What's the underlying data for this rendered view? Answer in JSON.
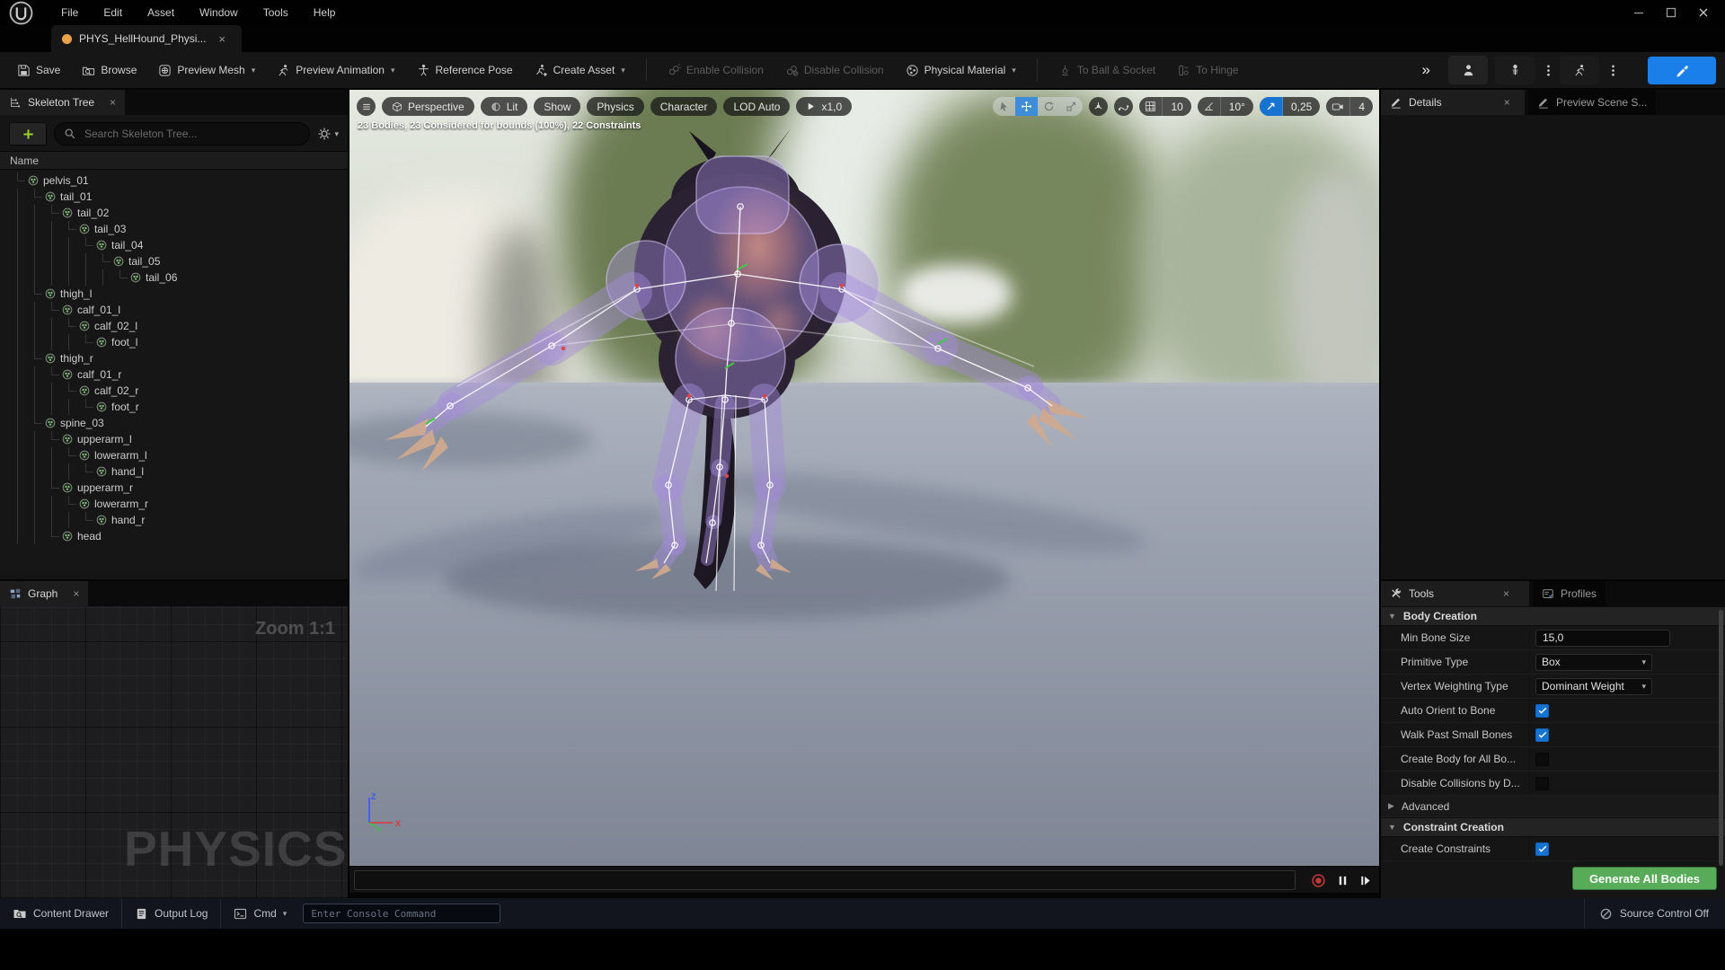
{
  "menubar": {
    "items": [
      "File",
      "Edit",
      "Asset",
      "Window",
      "Tools",
      "Help"
    ]
  },
  "window_controls": [
    "minimize",
    "maximize",
    "close"
  ],
  "tab": {
    "title": "PHYS_HellHound_Physi...",
    "modified": true,
    "close_icon": "x"
  },
  "toolbar": {
    "items": [
      {
        "label": "Save",
        "icon": "save"
      },
      {
        "label": "Browse",
        "icon": "folder-search"
      },
      {
        "label": "Preview Mesh",
        "icon": "preview-mesh",
        "dropdown": true
      },
      {
        "label": "Preview Animation",
        "icon": "runner",
        "dropdown": true
      },
      {
        "label": "Reference Pose",
        "icon": "t-pose"
      },
      {
        "label": "Create Asset",
        "icon": "runner-plus",
        "dropdown": true,
        "sep_after": true
      },
      {
        "label": "Enable Collision",
        "icon": "collision-on",
        "disabled": true
      },
      {
        "label": "Disable Collision",
        "icon": "collision-off",
        "disabled": true
      },
      {
        "label": "Physical Material",
        "icon": "material-sphere",
        "dropdown": true,
        "sep_after": true
      },
      {
        "label": "To Ball & Socket",
        "icon": "ball-socket",
        "disabled": true
      },
      {
        "label": "To Hinge",
        "icon": "hinge",
        "disabled": true
      }
    ],
    "overflow_icon": "chevrons-right",
    "right_icons": [
      "person",
      "skeleton",
      "kebab",
      "runner",
      "kebab"
    ],
    "primary_icon": "brush"
  },
  "skeleton_tree": {
    "tab": "Skeleton Tree",
    "search_placeholder": "Search Skeleton Tree...",
    "column": "Name",
    "bones": [
      {
        "name": "pelvis_01",
        "level": 1
      },
      {
        "name": "tail_01",
        "level": 2
      },
      {
        "name": "tail_02",
        "level": 3
      },
      {
        "name": "tail_03",
        "level": 4
      },
      {
        "name": "tail_04",
        "level": 5
      },
      {
        "name": "tail_05",
        "level": 6
      },
      {
        "name": "tail_06",
        "level": 7
      },
      {
        "name": "thigh_l",
        "level": 2
      },
      {
        "name": "calf_01_l",
        "level": 3
      },
      {
        "name": "calf_02_l",
        "level": 4
      },
      {
        "name": "foot_l",
        "level": 5
      },
      {
        "name": "thigh_r",
        "level": 2
      },
      {
        "name": "calf_01_r",
        "level": 3
      },
      {
        "name": "calf_02_r",
        "level": 4
      },
      {
        "name": "foot_r",
        "level": 5
      },
      {
        "name": "spine_03",
        "level": 2
      },
      {
        "name": "upperarm_l",
        "level": 3
      },
      {
        "name": "lowerarm_l",
        "level": 4
      },
      {
        "name": "hand_l",
        "level": 5
      },
      {
        "name": "upperarm_r",
        "level": 3
      },
      {
        "name": "lowerarm_r",
        "level": 4
      },
      {
        "name": "hand_r",
        "level": 5
      },
      {
        "name": "head",
        "level": 3
      }
    ]
  },
  "graph": {
    "tab": "Graph",
    "zoom_label": "Zoom 1:1",
    "watermark": "PHYSICS"
  },
  "viewport": {
    "pills": [
      "Perspective",
      "Lit",
      "Show",
      "Physics",
      "Character",
      "LOD Auto"
    ],
    "playback_speed": "x1,0",
    "stats": "23 Bodies, 23 Considered for bounds (100%), 22 Constraints",
    "grid_snap": "10",
    "angle_snap": "10°",
    "scale_snap": "0,25",
    "camera_speed": "4",
    "axis_labels": {
      "x": "X",
      "y": "Y",
      "z": "Z"
    }
  },
  "details": {
    "tab": "Details",
    "secondary_tab": "Preview Scene S..."
  },
  "tools": {
    "tab": "Tools",
    "profiles_tab": "Profiles",
    "sections": [
      {
        "title": "Body Creation",
        "rows": [
          {
            "label": "Min Bone Size",
            "type": "input",
            "value": "15,0"
          },
          {
            "label": "Primitive Type",
            "type": "dropdown",
            "value": "Box"
          },
          {
            "label": "Vertex Weighting Type",
            "type": "dropdown",
            "value": "Dominant Weight"
          },
          {
            "label": "Auto Orient to Bone",
            "type": "checkbox",
            "checked": true
          },
          {
            "label": "Walk Past Small Bones",
            "type": "checkbox",
            "checked": true
          },
          {
            "label": "Create Body for All Bo...",
            "type": "checkbox",
            "checked": false
          },
          {
            "label": "Disable Collisions by D...",
            "type": "checkbox",
            "checked": false
          },
          {
            "label": "Advanced",
            "type": "collapsed-category"
          }
        ]
      },
      {
        "title": "Constraint Creation",
        "rows": [
          {
            "label": "Create Constraints",
            "type": "checkbox",
            "checked": true
          }
        ]
      }
    ],
    "generate_button": "Generate All Bodies"
  },
  "status_bar": {
    "content_drawer": "Content Drawer",
    "output_log": "Output Log",
    "cmd": "Cmd",
    "console_placeholder": "Enter Console Command",
    "source_control": "Source Control Off"
  },
  "colors": {
    "accent_blue": "#1673d2",
    "generate_green": "#58ab58",
    "unsaved_orange": "#e8a24a",
    "record_red": "#c0392b",
    "plus_green": "#9acd32"
  }
}
